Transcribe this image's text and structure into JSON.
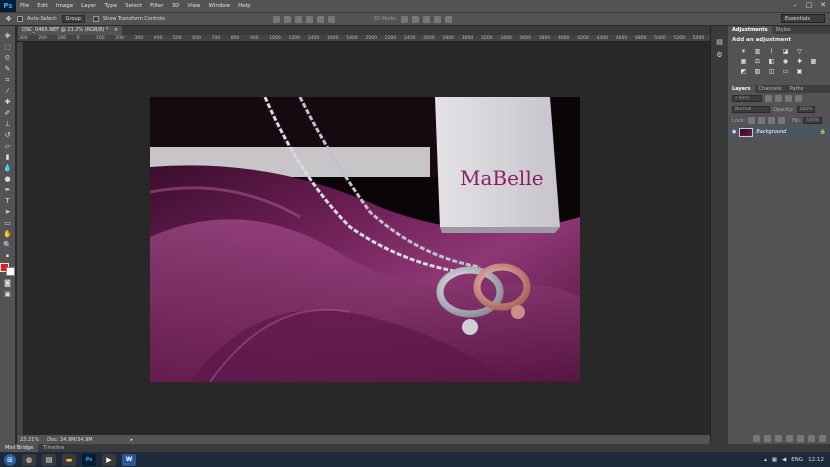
{
  "app": {
    "logo": "Ps"
  },
  "menu": [
    "File",
    "Edit",
    "Image",
    "Layer",
    "Type",
    "Select",
    "Filter",
    "3D",
    "View",
    "Window",
    "Help"
  ],
  "window_controls": {
    "minimize": "–",
    "maximize": "□",
    "close": "✕"
  },
  "options_bar": {
    "auto_select_label": "Auto-Select:",
    "auto_select_value": "Group",
    "transform_label": "Show Transform Controls",
    "mode_3d_label": "3D Mode:",
    "workspace": "Essentials"
  },
  "document": {
    "tab_title": "DSC_0465.NEF @ 23.2% (RGB/8) *",
    "close": "×"
  },
  "ruler_ticks": [
    "300",
    "200",
    "100",
    "0",
    "100",
    "200",
    "300",
    "400",
    "500",
    "600",
    "700",
    "800",
    "900",
    "1000",
    "1200",
    "1400",
    "1600",
    "1800",
    "2000",
    "2200",
    "2400",
    "2600",
    "2800",
    "3000",
    "3200",
    "3400",
    "3600",
    "3800",
    "4000",
    "4200",
    "4400",
    "4600",
    "4800",
    "5000",
    "5200",
    "5400"
  ],
  "photo": {
    "brand_text": "MaBelle"
  },
  "status": {
    "zoom": "23.21%",
    "doc_size": "Doc: 34.9M/34.9M"
  },
  "bottom_tabs": [
    "Mini Bridge",
    "Timeline"
  ],
  "adjustments": {
    "tabs": [
      "Adjustments",
      "Styles"
    ],
    "title": "Add an adjustment",
    "icons": [
      "brightness-icon",
      "levels-icon",
      "curves-icon",
      "exposure-icon",
      "vibrance-icon",
      "hue-icon",
      "color-balance-icon",
      "bw-icon",
      "photo-filter-icon",
      "channel-mixer-icon",
      "color-lookup-icon",
      "invert-icon",
      "posterize-icon",
      "threshold-icon",
      "gradient-map-icon",
      "selective-color-icon"
    ]
  },
  "layers": {
    "tabs": [
      "Layers",
      "Channels",
      "Paths"
    ],
    "kind": "Kind",
    "blend_mode": "Normal",
    "opacity_label": "Opacity:",
    "opacity_value": "100%",
    "lock_label": "Lock:",
    "fill_label": "Fill:",
    "fill_value": "100%",
    "items": [
      {
        "name": "Background"
      }
    ]
  },
  "taskbar": {
    "language": "ENG",
    "time": "12:12"
  },
  "colors": {
    "foreground": "#e41c1c",
    "background": "#ffffff",
    "brand_purple": "#8a1f63"
  }
}
